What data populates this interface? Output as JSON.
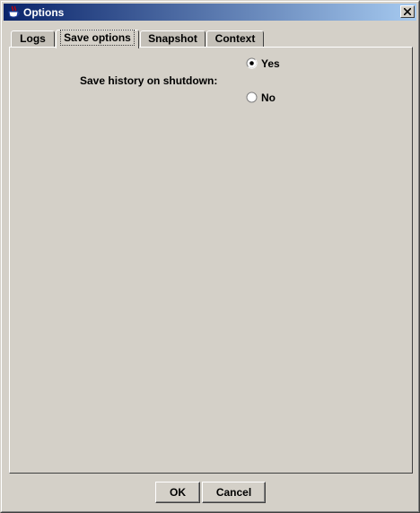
{
  "window": {
    "title": "Options",
    "icon": "java-cup-icon",
    "close_icon": "close-icon"
  },
  "tabs": [
    {
      "label": "Logs",
      "selected": false
    },
    {
      "label": "Save options",
      "selected": true
    },
    {
      "label": "Snapshot",
      "selected": false
    },
    {
      "label": "Context",
      "selected": false
    }
  ],
  "save_options": {
    "history_label": "Save history on shutdown:",
    "options": [
      {
        "label": "Yes",
        "checked": true
      },
      {
        "label": "No",
        "checked": false
      }
    ]
  },
  "buttons": {
    "ok": "OK",
    "cancel": "Cancel"
  },
  "colors": {
    "title_gradient_start": "#0a246a",
    "title_gradient_end": "#a6caf0",
    "face": "#d4d0c8"
  }
}
